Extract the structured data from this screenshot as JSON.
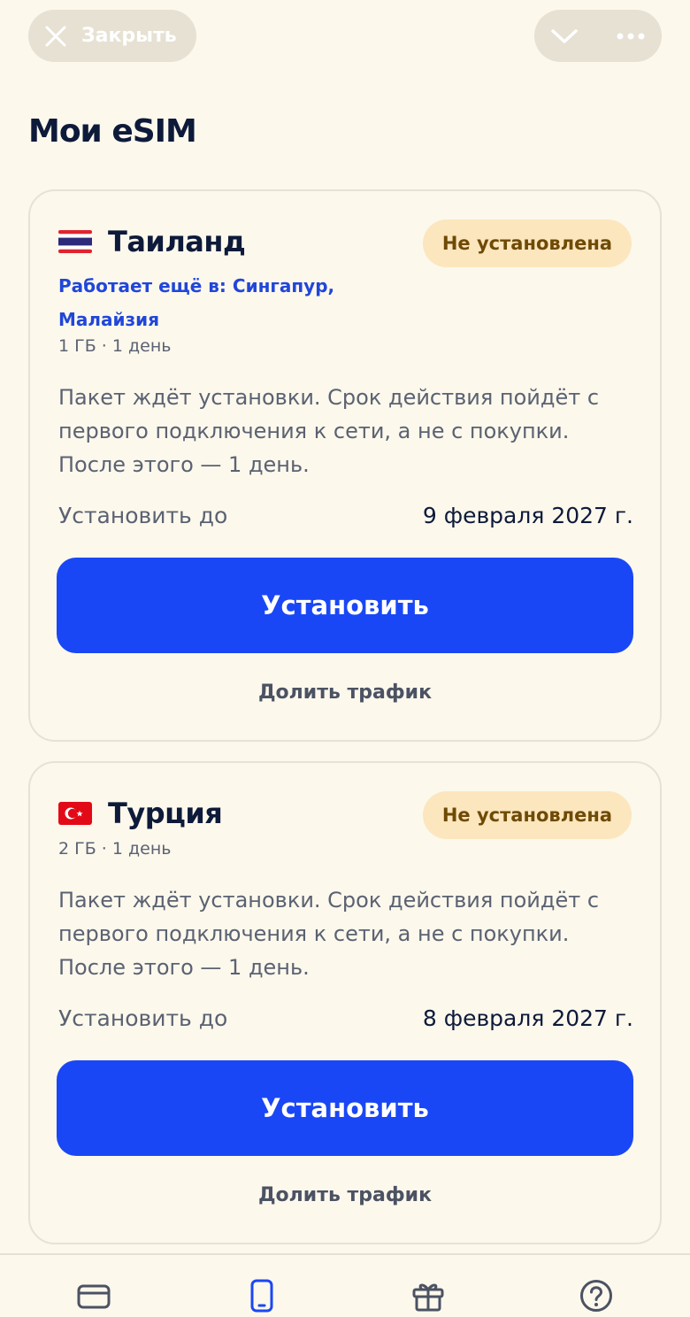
{
  "header": {
    "close_label": "Закрыть",
    "close_icon": "close-icon",
    "collapse_icon": "chevron-down-icon",
    "more_icon": "more-dots-icon"
  },
  "page": {
    "title": "Мои eSIM"
  },
  "cards": [
    {
      "country": "Таиланд",
      "flag_icon": "thailand-flag-icon",
      "status": "Не установлена",
      "also_works": "Работает ещё в: Сингапур, Малайзия",
      "plan": "1 ГБ · 1 день",
      "description": "Пакет ждёт установки. Срок действия пойдёт с первого подключения к сети, а не с покупки. После этого — 1 день.",
      "deadline_label": "Установить до",
      "deadline_value": "9 февраля 2027 г.",
      "install_label": "Установить",
      "share_label": "Долить трафик"
    },
    {
      "country": "Турция",
      "flag_icon": "turkey-flag-icon",
      "status": "Не установлена",
      "plan": "2 ГБ · 1 день",
      "description": "Пакет ждёт установки. Срок действия пойдёт с первого подключения к сети, а не с покупки. После этого — 1 день.",
      "deadline_label": "Установить до",
      "deadline_value": "8 февраля 2027 г.",
      "install_label": "Установить",
      "share_label": "Долить трафик"
    }
  ],
  "tabbar": {
    "items": [
      {
        "icon": "card-icon",
        "active": false
      },
      {
        "icon": "phone-icon",
        "active": true
      },
      {
        "icon": "gift-icon",
        "active": false
      },
      {
        "icon": "help-icon",
        "active": false
      }
    ]
  },
  "colors": {
    "accent": "#1A47F5",
    "background": "#FCF8EC",
    "badge_bg": "#FCE6BE",
    "badge_text": "#6E4A05",
    "link": "#2146D9"
  }
}
